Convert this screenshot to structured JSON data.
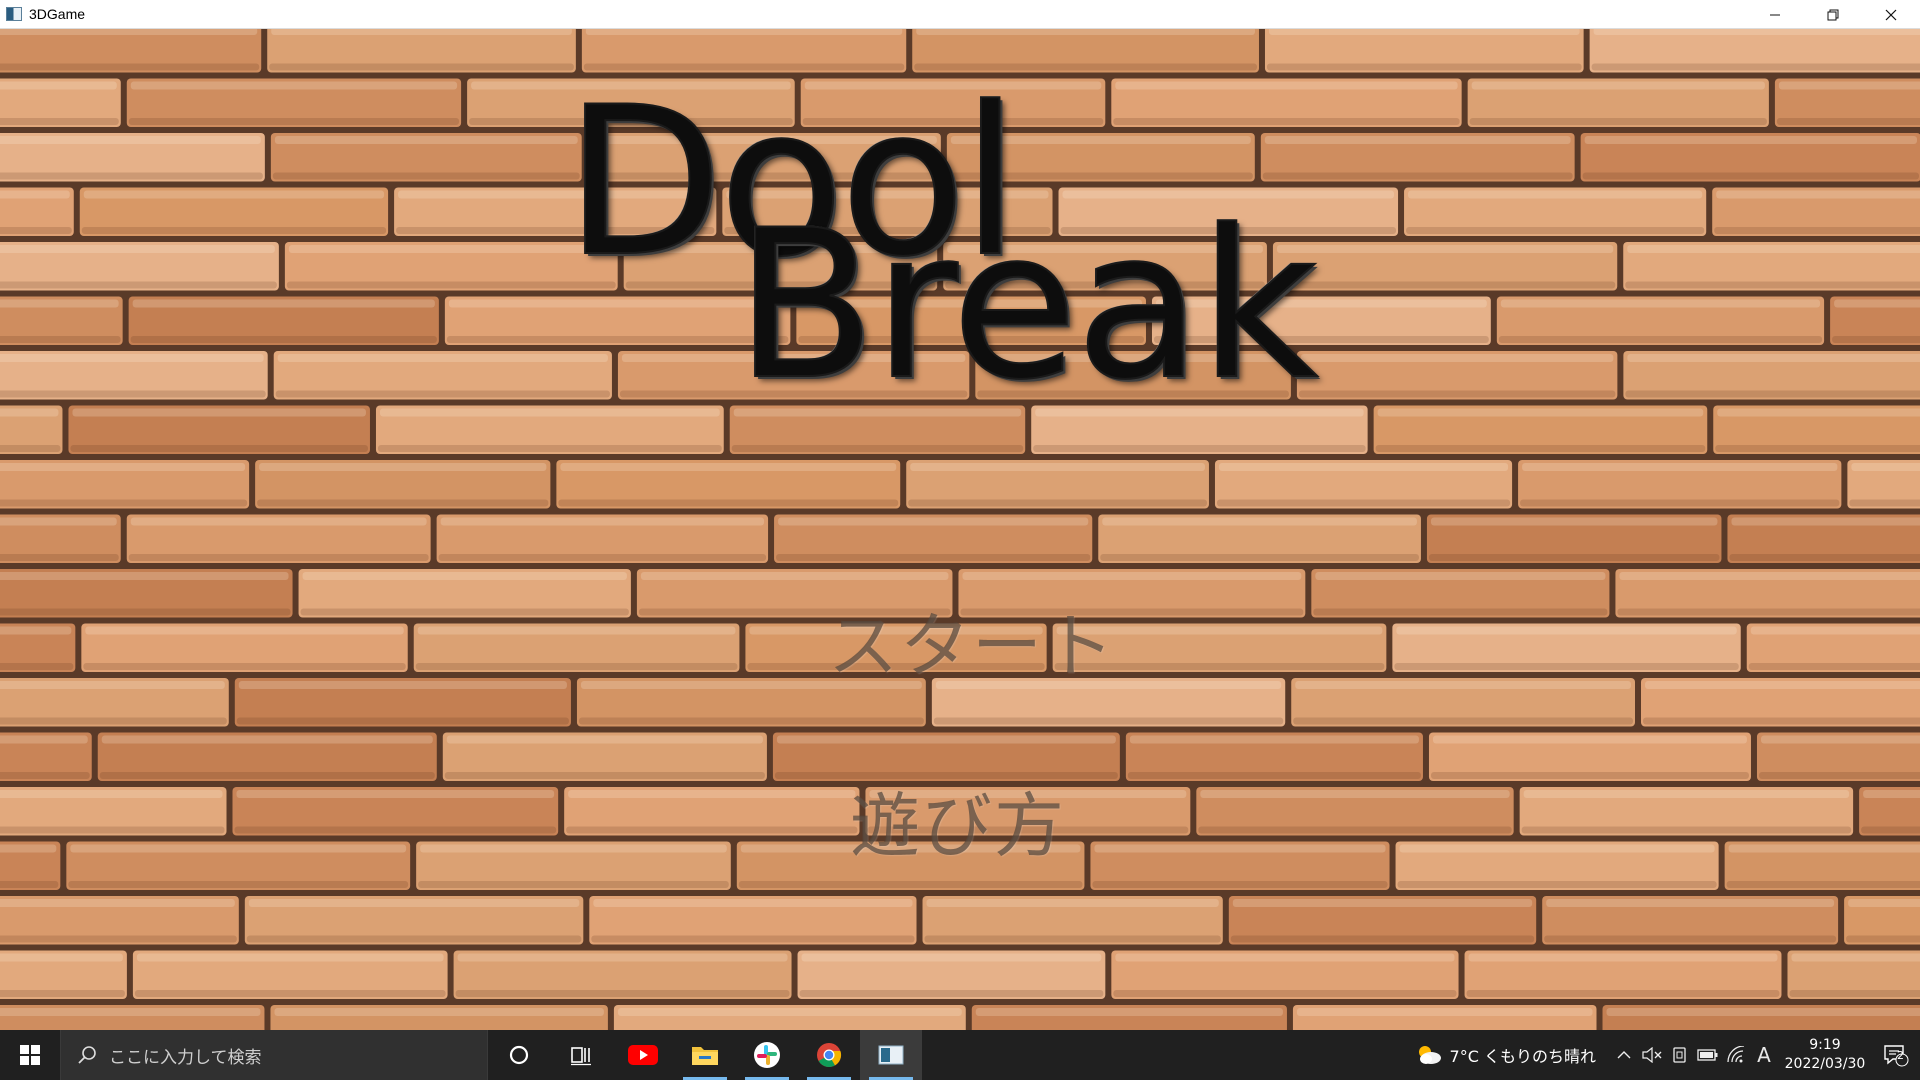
{
  "window": {
    "title": "3DGame",
    "controls": {
      "minimize": "—",
      "restore": "❐",
      "close": "✕"
    }
  },
  "game": {
    "title_line1": "Dool",
    "title_line2": "Break",
    "menu": {
      "start": "スタート",
      "how_to_play": "遊び方"
    },
    "background": "brick-wall"
  },
  "taskbar": {
    "search_placeholder": "ここに入力して検索",
    "pinned": [
      "cortana-icon",
      "task-view-icon",
      "youtube-icon",
      "file-explorer-icon",
      "slack-icon",
      "chrome-icon",
      "3dgame-app-icon"
    ],
    "weather": "7°C  くもりのち晴れ",
    "ime_indicator": "A",
    "time": "9:19",
    "date": "2022/03/30",
    "notification_count": "2"
  },
  "colors": {
    "taskbar": "#202020",
    "accent_underline": "#76b9ed",
    "menu_text": "#55463c"
  }
}
